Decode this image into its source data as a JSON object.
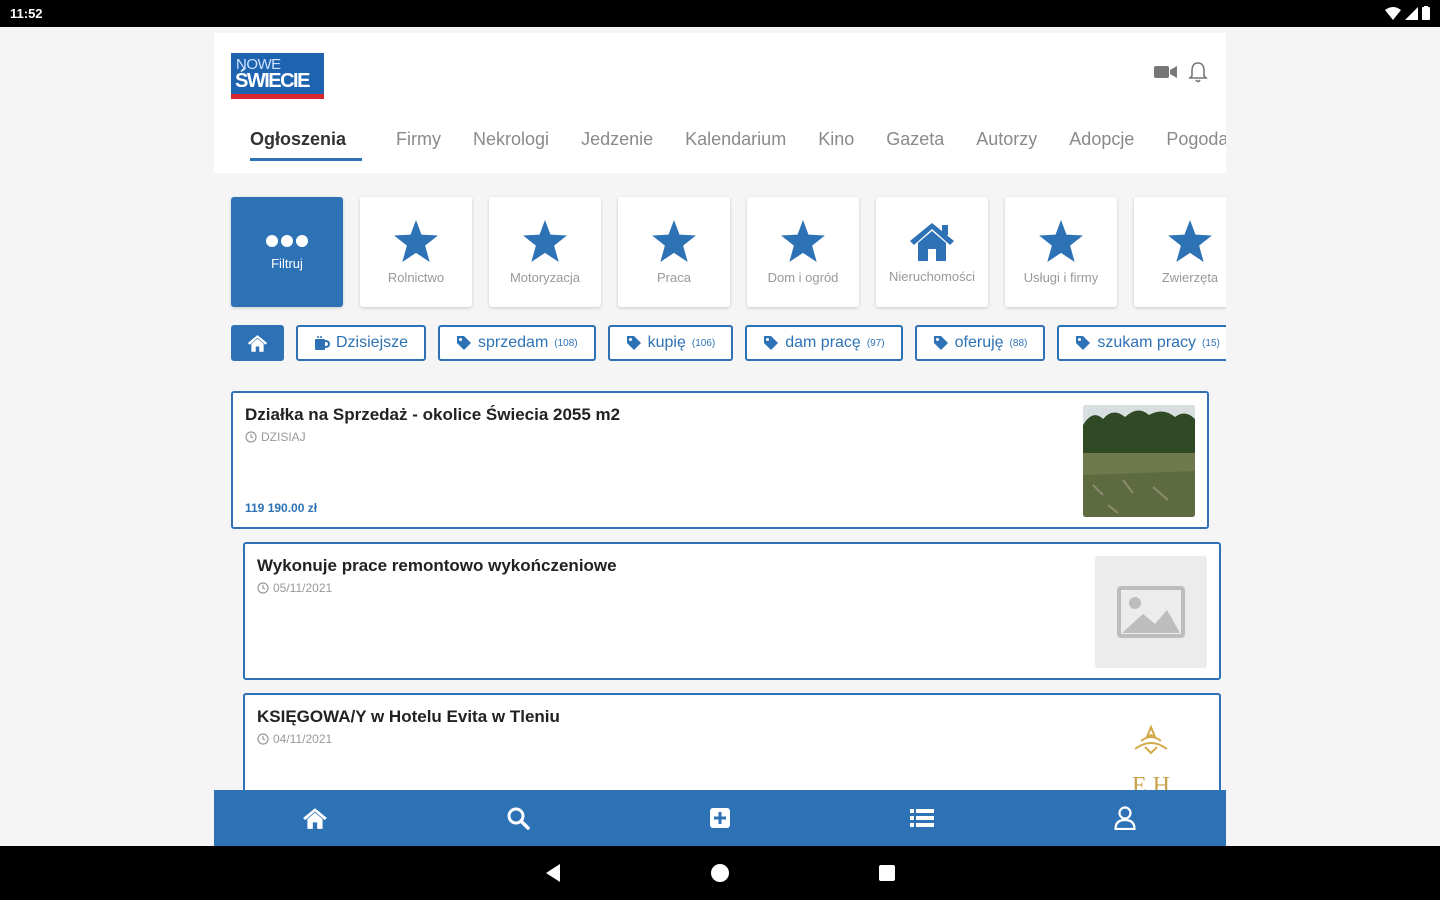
{
  "status_bar": {
    "time": "11:52"
  },
  "app": {
    "logo": {
      "line1": "NOWE",
      "line2": "ŚWIECIE"
    },
    "header_icons": [
      "video-camera-icon",
      "bell-icon"
    ],
    "nav_tabs": [
      "Ogłoszenia",
      "Firmy",
      "Nekrologi",
      "Jedzenie",
      "Kalendarium",
      "Kino",
      "Gazeta",
      "Autorzy",
      "Adopcje",
      "Pogoda"
    ],
    "active_tab": "Ogłoszenia",
    "categories": [
      {
        "label": "Filtruj",
        "icon": "more-dots-icon",
        "active": true
      },
      {
        "label": "Rolnictwo",
        "icon": "star-icon"
      },
      {
        "label": "Motoryzacja",
        "icon": "star-icon"
      },
      {
        "label": "Praca",
        "icon": "star-icon"
      },
      {
        "label": "Dom i ogród",
        "icon": "star-icon"
      },
      {
        "label": "Nieruchomości",
        "icon": "house-icon"
      },
      {
        "label": "Usługi i firmy",
        "icon": "star-icon"
      },
      {
        "label": "Zwierzęta",
        "icon": "star-icon"
      }
    ],
    "chips": [
      {
        "label": "",
        "icon": "home-icon",
        "home": true
      },
      {
        "label": "Dzisiejsze",
        "icon": "mug-icon",
        "count": ""
      },
      {
        "label": "sprzedam",
        "icon": "tag-icon",
        "count": "(108)"
      },
      {
        "label": "kupię",
        "icon": "tag-icon",
        "count": "(106)"
      },
      {
        "label": "dam pracę",
        "icon": "tag-icon",
        "count": "(97)"
      },
      {
        "label": "oferuję",
        "icon": "tag-icon",
        "count": "(88)"
      },
      {
        "label": "szukam pracy",
        "icon": "tag-icon",
        "count": "(15)"
      }
    ],
    "listings": [
      {
        "title": "Działka na Sprzedaż - okolice Świecia 2055 m2",
        "date": "DZISIAJ",
        "price": "119 190.00 zł",
        "image": "field-photo"
      },
      {
        "title": "Wykonuje prace remontowo wykończeniowe",
        "date": "05/11/2021",
        "price": "",
        "image": "placeholder-image-icon"
      },
      {
        "title": "KSIĘGOWA/Y w Hotelu Evita w Tleniu",
        "date": "04/11/2021",
        "price": "",
        "image": "hotel-logo",
        "logo_text": "E H"
      }
    ],
    "bottom_nav": [
      "home-icon",
      "search-icon",
      "add-icon",
      "list-icon",
      "user-icon"
    ],
    "colors": {
      "brand": "#2d72b5",
      "logo_bg": "#1e63b0",
      "logo_accent": "#d8262e"
    }
  }
}
